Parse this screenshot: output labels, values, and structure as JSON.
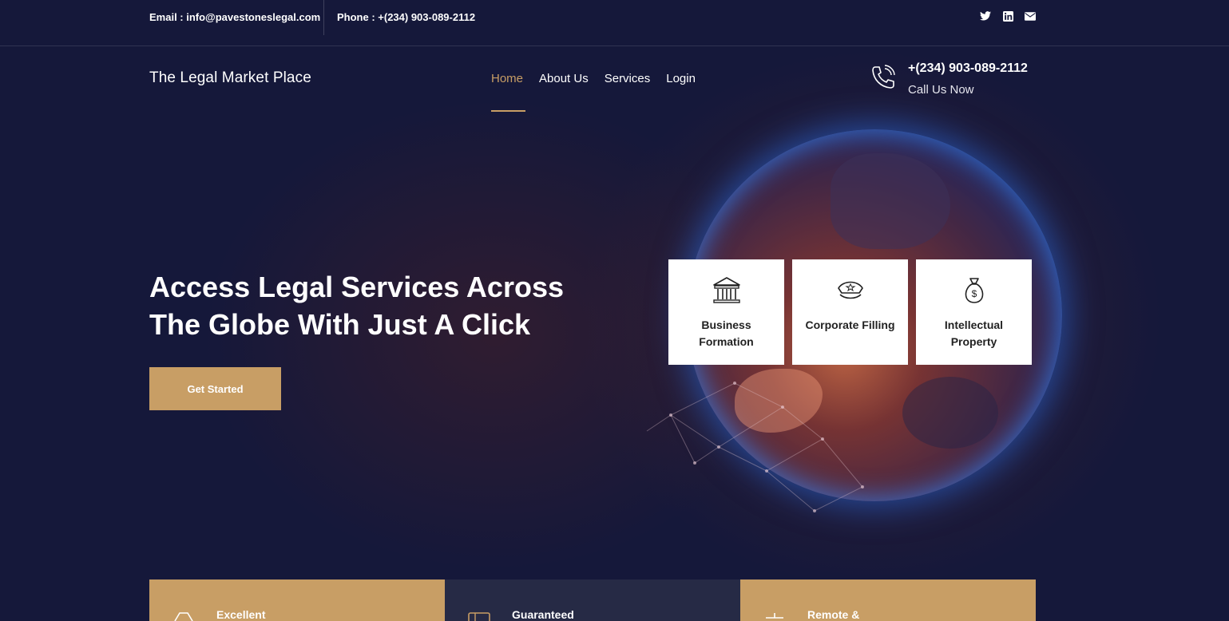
{
  "topbar": {
    "email": "Email : info@pavestoneslegal.com",
    "phone": "Phone : +(234) 903-089-2112",
    "social": [
      {
        "name": "twitter-icon",
        "glyph": "🐦"
      },
      {
        "name": "linkedin-icon",
        "glyph": "in"
      },
      {
        "name": "mail-icon",
        "glyph": "✉"
      }
    ]
  },
  "header": {
    "brand": "The Legal Market Place",
    "nav": [
      {
        "label": "Home",
        "active": true
      },
      {
        "label": "About Us",
        "active": false
      },
      {
        "label": "Services",
        "active": false
      },
      {
        "label": "Login",
        "active": false
      }
    ],
    "call_number": "+(234) 903-089-2112",
    "call_label": "Call Us Now"
  },
  "hero": {
    "title": "Access Legal Services Across The Globe With Just A Click",
    "cta_label": "Get Started"
  },
  "cards": [
    {
      "label": "Business Formation",
      "icon": "bank-icon"
    },
    {
      "label": "Corporate Filling",
      "icon": "police-cap-icon"
    },
    {
      "label": "Intellectual Property",
      "icon": "money-bag-icon"
    }
  ],
  "features": [
    {
      "label": "Excellent",
      "icon": "scale-icon",
      "style": "gold"
    },
    {
      "label": "Guaranteed",
      "icon": "book-icon",
      "style": "dark"
    },
    {
      "label": "Remote &",
      "icon": "gavel-icon",
      "style": "gold"
    }
  ],
  "colors": {
    "accent": "#c89e65",
    "background": "#15183a",
    "card_bg": "#ffffff",
    "feature_dark": "#262a45"
  }
}
